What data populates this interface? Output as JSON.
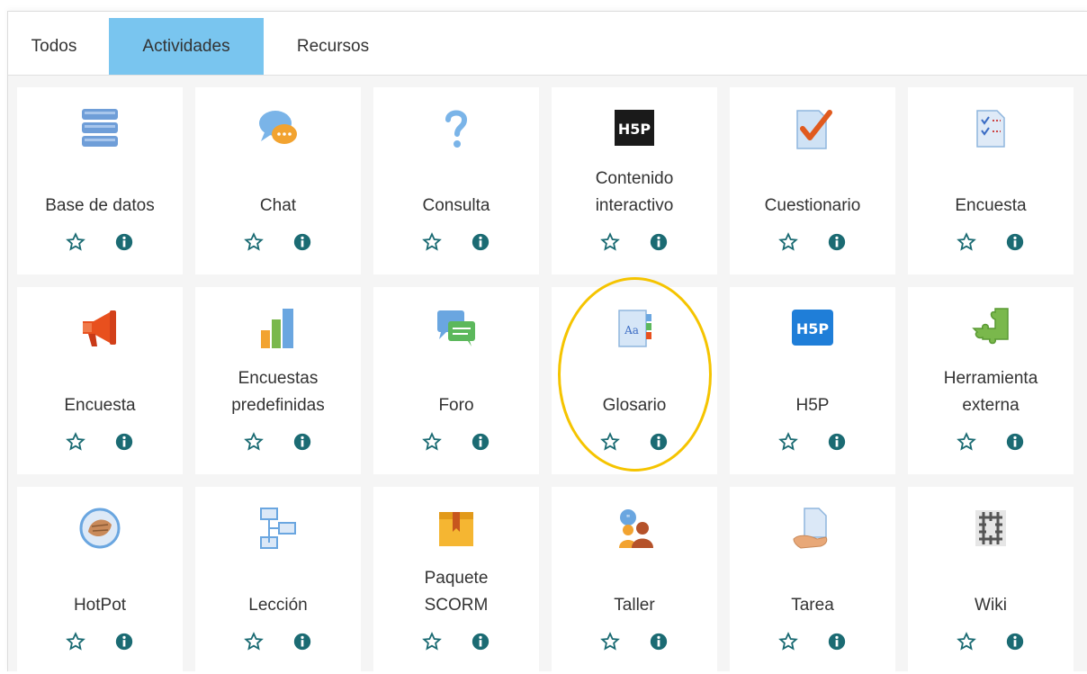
{
  "tabs": [
    {
      "label": "Todos",
      "active": false
    },
    {
      "label": "Actividades",
      "active": true
    },
    {
      "label": "Recursos",
      "active": false
    }
  ],
  "colors": {
    "active_tab": "#79c5ef",
    "action_icon": "#1b6b73",
    "highlight": "#f5c400"
  },
  "tiles": [
    {
      "label": "Base de datos",
      "icon": "database-icon"
    },
    {
      "label": "Chat",
      "icon": "chat-icon"
    },
    {
      "label": "Consulta",
      "icon": "question-icon"
    },
    {
      "label": "Contenido\ninteractivo",
      "icon": "h5p-icon"
    },
    {
      "label": "Cuestionario",
      "icon": "quiz-icon"
    },
    {
      "label": "Encuesta",
      "icon": "survey-icon"
    },
    {
      "label": "Encuesta",
      "icon": "megaphone-icon"
    },
    {
      "label": "Encuestas\npredefinidas",
      "icon": "bar-chart-icon"
    },
    {
      "label": "Foro",
      "icon": "forum-icon"
    },
    {
      "label": "Glosario",
      "icon": "glossary-icon"
    },
    {
      "label": "H5P",
      "icon": "h5p-icon"
    },
    {
      "label": "Herramienta\nexterna",
      "icon": "puzzle-icon"
    },
    {
      "label": "HotPot",
      "icon": "hotpot-icon"
    },
    {
      "label": "Lección",
      "icon": "lesson-icon"
    },
    {
      "label": "Paquete\nSCORM",
      "icon": "package-icon"
    },
    {
      "label": "Taller",
      "icon": "workshop-icon"
    },
    {
      "label": "Tarea",
      "icon": "assignment-icon"
    },
    {
      "label": "Wiki",
      "icon": "wiki-icon"
    }
  ]
}
